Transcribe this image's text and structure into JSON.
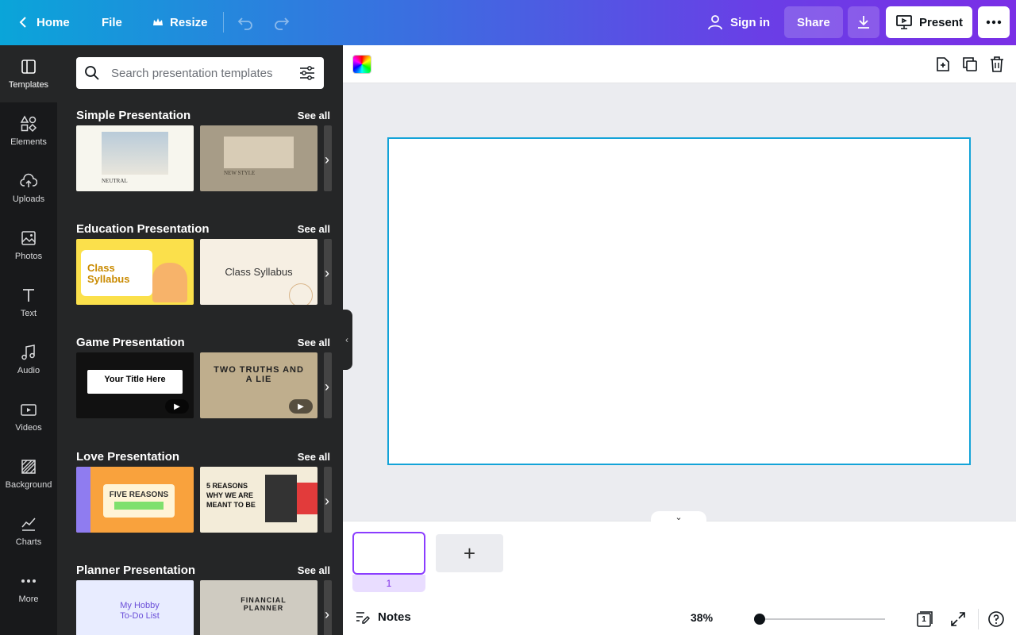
{
  "topbar": {
    "home": "Home",
    "file": "File",
    "resize": "Resize",
    "signin": "Sign in",
    "share": "Share",
    "present": "Present"
  },
  "rail": [
    {
      "label": "Templates",
      "icon": "layout-icon"
    },
    {
      "label": "Elements",
      "icon": "shapes-icon"
    },
    {
      "label": "Uploads",
      "icon": "cloud-upload-icon"
    },
    {
      "label": "Photos",
      "icon": "image-icon"
    },
    {
      "label": "Text",
      "icon": "text-icon"
    },
    {
      "label": "Audio",
      "icon": "music-icon"
    },
    {
      "label": "Videos",
      "icon": "video-icon"
    },
    {
      "label": "Background",
      "icon": "background-icon"
    },
    {
      "label": "Charts",
      "icon": "chart-icon"
    },
    {
      "label": "More",
      "icon": "dots-icon"
    }
  ],
  "search": {
    "placeholder": "Search presentation templates"
  },
  "sections": [
    {
      "title": "Simple Presentation",
      "see_all": "See all",
      "thumbs": [
        {
          "text": "NEUTRAL",
          "bg": "#f7f6ee"
        },
        {
          "text": "NEW STYLE",
          "bg": "#a79c87"
        }
      ]
    },
    {
      "title": "Education Presentation",
      "see_all": "See all",
      "thumbs": [
        {
          "text": "Class Syllabus",
          "bg": "#fbe04b"
        },
        {
          "text": "Class Syllabus",
          "bg": "#f6efe3"
        }
      ]
    },
    {
      "title": "Game Presentation",
      "see_all": "See all",
      "thumbs": [
        {
          "text": "Your Title Here",
          "bg": "#111111"
        },
        {
          "text": "TWO TRUTHS AND A LIE",
          "bg": "#bfae8d"
        }
      ]
    },
    {
      "title": "Love Presentation",
      "see_all": "See all",
      "thumbs": [
        {
          "text": "FIVE REASONS",
          "bg": "#f9a23d"
        },
        {
          "text": "5 REASONS WHY WE ARE MEANT TO BE",
          "bg": "#f3ecd9"
        }
      ]
    },
    {
      "title": "Planner Presentation",
      "see_all": "See all",
      "thumbs": [
        {
          "text": "My Hobby To-Do List",
          "bg": "#e8ecff"
        },
        {
          "text": "FINANCIAL PLANNER",
          "bg": "#cfcbc1"
        }
      ]
    }
  ],
  "bottom": {
    "page_number": "1",
    "notes": "Notes",
    "zoom": "38%",
    "page_count": "1"
  }
}
